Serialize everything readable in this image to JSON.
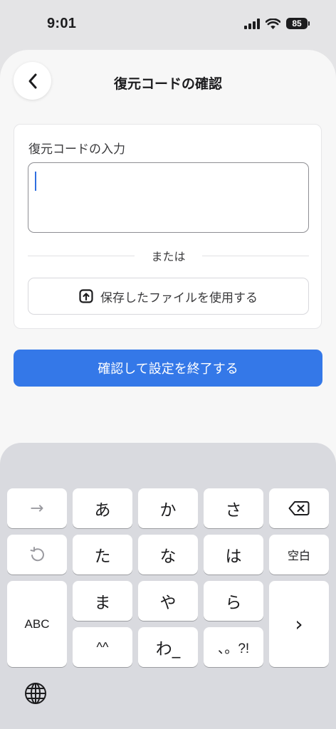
{
  "status_bar": {
    "time": "9:01",
    "battery": "85"
  },
  "header": {
    "title": "復元コードの確認"
  },
  "form": {
    "label": "復元コードの入力",
    "input_value": "",
    "or_text": "または",
    "file_button_label": "保存したファイルを使用する"
  },
  "confirm_button_label": "確認して設定を終了する",
  "keyboard": {
    "row1": [
      "→",
      "あ",
      "か",
      "さ"
    ],
    "row2": [
      "た",
      "な",
      "は"
    ],
    "space_label": "空白",
    "abc_label": "ABC",
    "row3": [
      "ま",
      "や",
      "ら"
    ],
    "row4": [
      "^^",
      "わ_",
      "、。?!"
    ],
    "next_label": "›",
    "backspace_icon": "delete-left-icon",
    "undo_icon": "undo-icon",
    "globe_icon": "globe-icon"
  },
  "colors": {
    "accent": "#3478e8",
    "caret": "#2f6fe0",
    "sheet": "#f7f7f7",
    "keyboard": "#d9dadf"
  }
}
